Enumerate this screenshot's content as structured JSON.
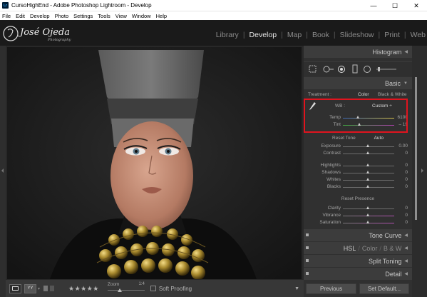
{
  "window": {
    "title": "CursoHighEnd - Adobe Photoshop Lightroom - Develop",
    "app_icon": "Lr",
    "controls": {
      "minimize": "—",
      "maximize": "☐",
      "close": "✕"
    }
  },
  "menu": [
    "File",
    "Edit",
    "Develop",
    "Photo",
    "Settings",
    "Tools",
    "View",
    "Window",
    "Help"
  ],
  "identity": {
    "logo_text": "José Ojeda",
    "logo_sub": "Photography",
    "modules": [
      "Library",
      "Develop",
      "Map",
      "Book",
      "Slideshow",
      "Print",
      "Web"
    ],
    "active_module": "Develop"
  },
  "toolbar": {
    "stars": "★★★★★",
    "zoom_label": "Zoom",
    "zoom_value": "1:4",
    "soft_proofing": "Soft Proofing"
  },
  "panel": {
    "histogram": "Histogram",
    "basic": "Basic",
    "treatment_label": "Treatment :",
    "treatment_color": "Color",
    "treatment_bw": "Black & White",
    "wb_label": "WB :",
    "wb_value": "Custom ÷",
    "temp_label": "Temp",
    "temp_value": "6100",
    "tint_label": "Tint",
    "tint_value": "– 19",
    "tone_label": "Reset Tone",
    "tone_auto": "Auto",
    "tone_sliders": [
      {
        "label": "Exposure",
        "value": "0.00"
      },
      {
        "label": "Contrast",
        "value": "0"
      },
      {
        "label": "Highlights",
        "value": "0"
      },
      {
        "label": "Shadows",
        "value": "0"
      },
      {
        "label": "Whites",
        "value": "0"
      },
      {
        "label": "Blacks",
        "value": "0"
      }
    ],
    "presence_label": "Reset Presence",
    "presence_sliders": [
      {
        "label": "Clarity",
        "value": "0"
      },
      {
        "label": "Vibrance",
        "value": "0"
      },
      {
        "label": "Saturation",
        "value": "0"
      }
    ],
    "tone_curve": "Tone Curve",
    "hsl": "HSL",
    "hsl_color": "Color",
    "hsl_bw": "B & W",
    "split_toning": "Split Toning",
    "detail": "Detail",
    "previous": "Previous",
    "set_default": "Set Default..."
  },
  "colors": {
    "highlight": "#e0141e",
    "panel_bg": "#303030",
    "identity_bg": "#1a1a1a"
  }
}
